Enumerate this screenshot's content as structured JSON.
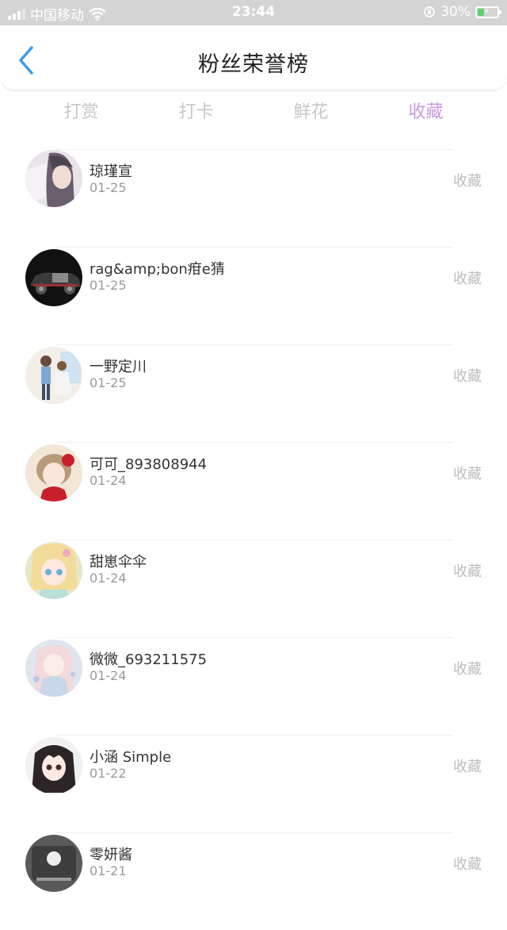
{
  "status_bar": {
    "carrier": "中国移动",
    "time": "23:44",
    "battery": "30%"
  },
  "header": {
    "title": "粉丝荣誉榜"
  },
  "tabs": [
    {
      "label": "打赏",
      "active": false
    },
    {
      "label": "打卡",
      "active": false
    },
    {
      "label": "鲜花",
      "active": false
    },
    {
      "label": "收藏",
      "active": true
    }
  ],
  "fans": [
    {
      "name": "琼瑾宣",
      "date": "01-25",
      "action": "收藏"
    },
    {
      "name": "rag&amp;bon疳e猜",
      "date": "01-25",
      "action": "收藏"
    },
    {
      "name": "一野定川",
      "date": "01-25",
      "action": "收藏"
    },
    {
      "name": "可可_893808944",
      "date": "01-24",
      "action": "收藏"
    },
    {
      "name": "甜崽伞伞",
      "date": "01-24",
      "action": "收藏"
    },
    {
      "name": "微微_693211575",
      "date": "01-24",
      "action": "收藏"
    },
    {
      "name": "小涵 Simple",
      "date": "01-22",
      "action": "收藏"
    },
    {
      "name": "零妍酱",
      "date": "01-21",
      "action": "收藏"
    }
  ],
  "colors": {
    "accent_back": "#3a9fe8",
    "tab_active": "#c89be0",
    "tab_inactive": "#c7c7c7"
  }
}
